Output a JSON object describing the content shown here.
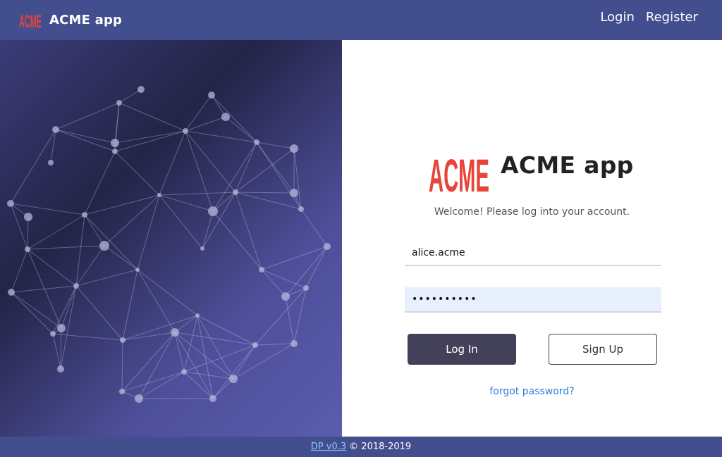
{
  "header": {
    "logo_text": "ACME",
    "app_name": "ACME app",
    "nav": {
      "login": "Login",
      "register": "Register"
    }
  },
  "login_panel": {
    "logo_text": "ACME",
    "title": "ACME app",
    "welcome": "Welcome! Please log into your account.",
    "username_value": "alice.acme",
    "password_value": "••••••••••",
    "login_button": "Log In",
    "signup_button": "Sign Up",
    "forgot_link": "forgot password?"
  },
  "footer": {
    "version_link": "DP v0.3",
    "copyright": "© 2018-2019"
  },
  "colors": {
    "header_bg": "#434e8f",
    "logo_red": "#e8443a",
    "login_button_bg": "#434159",
    "link_blue": "#2f7fd6"
  },
  "icons": {
    "brand": "acme-logo-icon",
    "hero": "network-sphere-graphic"
  }
}
